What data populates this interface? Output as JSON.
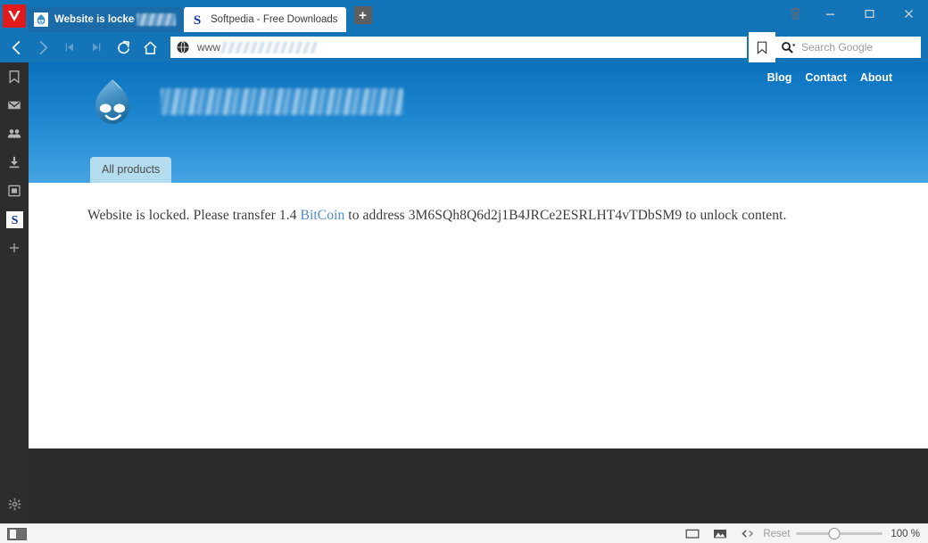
{
  "window": {
    "app_name": "Vivaldi",
    "trash_icon": "trash-icon",
    "minimize_label": "–",
    "maximize_label": "▭",
    "close_label": "×"
  },
  "tabs": [
    {
      "label": "Website is locked! |",
      "favicon": "drupal-favicon",
      "active": true,
      "has_blurred_title": true
    },
    {
      "label": "Softpedia - Free Downloads",
      "favicon": "softpedia-favicon",
      "active": false,
      "has_blurred_title": false
    }
  ],
  "newtab": {
    "label": "+"
  },
  "toolbar": {
    "back_icon": "back-arrow-icon",
    "forward_icon": "forward-arrow-icon",
    "rewind_icon": "rewind-icon",
    "fastforward_icon": "fast-forward-icon",
    "reload_icon": "reload-icon",
    "home_icon": "home-icon",
    "bookmark_icon": "bookmark-icon"
  },
  "address_bar": {
    "site_icon": "globe-icon",
    "value": "www",
    "blurred_remainder": true
  },
  "search_bar": {
    "icon": "search-icon",
    "placeholder": "Search Google",
    "value": ""
  },
  "panel": {
    "items": [
      {
        "label": "Bookmarks",
        "icon": "bookmark-panel-icon"
      },
      {
        "label": "Mail",
        "icon": "mail-icon"
      },
      {
        "label": "Contacts",
        "icon": "contacts-icon"
      },
      {
        "label": "Downloads",
        "icon": "download-icon"
      },
      {
        "label": "Notes",
        "icon": "notes-icon"
      },
      {
        "label": "Softpedia Web Panel",
        "icon": "softpedia-favicon"
      },
      {
        "label": "Add Web Panel",
        "icon": "plus-icon"
      }
    ],
    "settings": {
      "label": "Settings",
      "icon": "gear-icon"
    }
  },
  "page": {
    "logo_icon": "drupal-druplicon-logo",
    "site_title_blurred": true,
    "nav": [
      "Blog",
      "Contact",
      "About"
    ],
    "active_tab": "All products",
    "message": {
      "before_link": "Website is locked. Please transfer 1.4 ",
      "link_text": "BitCoin",
      "after_link": " to address 3M6SQh8Q6d2j1B4JRCe2ESRLHT4vTDbSM9 to unlock content.",
      "bitcoin_amount": "1.4",
      "bitcoin_address": "3M6SQh8Q6d2j1B4JRCe2ESRLHT4vTDbSM9"
    }
  },
  "statusbar": {
    "panel_toggle_icon": "panel-toggle-icon",
    "tile_icon": "tile-icon",
    "images_icon": "images-icon",
    "devtools_icon": "code-arrows-icon",
    "reset_label": "Reset",
    "zoom_value": "100 %",
    "zoom_percent": 100
  },
  "colors": {
    "chrome_blue": "#1374b8",
    "active_tab_blue": "#1a6ba8",
    "vivaldi_red": "#e01b1b",
    "panel_dark": "#2d2d2d",
    "backdrop_dark": "#2b2b2b",
    "page_header_top": "#0a71bd",
    "page_header_bottom": "#44a3e2",
    "product_tab": "#b4dcef",
    "link_blue": "#4f8ecc"
  }
}
